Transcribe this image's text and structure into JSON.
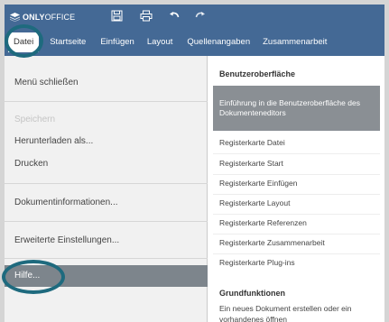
{
  "app": {
    "brand_bold": "ONLY",
    "brand_thin": "OFFICE"
  },
  "titlebar_icons": [
    "save-icon",
    "print-icon",
    "undo-icon",
    "redo-icon"
  ],
  "tabs": [
    {
      "label": "Datei",
      "active": true
    },
    {
      "label": "Startseite"
    },
    {
      "label": "Einfügen"
    },
    {
      "label": "Layout"
    },
    {
      "label": "Quellenangaben"
    },
    {
      "label": "Zusammenarbeit"
    }
  ],
  "file_menu": {
    "close": "Menü schließen",
    "save": "Speichern",
    "download": "Herunterladen als...",
    "print": "Drucken",
    "info": "Dokumentinformationen...",
    "settings": "Erweiterte Einstellungen...",
    "help": "Hilfe..."
  },
  "help": {
    "section1": "Benutzeroberfläche",
    "items": [
      "Einführung in die Benutzeroberfläche des Dokumenteneditors",
      "Registerkarte Datei",
      "Registerkarte Start",
      "Registerkarte Einfügen",
      "Registerkarte Layout",
      "Registerkarte Referenzen",
      "Registerkarte Zusammenarbeit",
      "Registerkarte Plug-ins"
    ],
    "section2": "Grundfunktionen",
    "item2": "Ein neues Dokument erstellen oder ein vorhandenes öffnen"
  },
  "colors": {
    "header": "#446995",
    "highlight_ring": "#1e6a7e",
    "selected_menu": "#7d858c"
  }
}
